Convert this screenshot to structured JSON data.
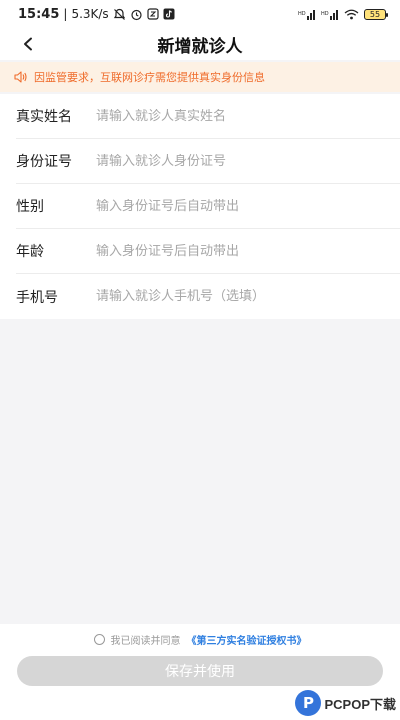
{
  "status_bar": {
    "time": "15:45",
    "speed": "5.3K/s",
    "battery": "55"
  },
  "navbar": {
    "title": "新增就诊人"
  },
  "notice": {
    "text": "因监管要求，互联网诊疗需您提供真实身份信息",
    "color": "#ef6b2a"
  },
  "form": {
    "fields": [
      {
        "label": "真实姓名",
        "placeholder": "请输入就诊人真实姓名",
        "value": ""
      },
      {
        "label": "身份证号",
        "placeholder": "请输入就诊人身份证号",
        "value": ""
      },
      {
        "label": "性别",
        "placeholder": "输入身份证号后自动带出",
        "value": ""
      },
      {
        "label": "年龄",
        "placeholder": "输入身份证号后自动带出",
        "value": ""
      },
      {
        "label": "手机号",
        "placeholder": "请输入就诊人手机号（选填）",
        "value": ""
      }
    ]
  },
  "agreement": {
    "prefix": "我已阅读并同意",
    "link": "《第三方实名验证授权书》"
  },
  "save_button": {
    "label": "保存并使用"
  },
  "watermark": {
    "logo_letter": "P",
    "text": "PCPOP下载"
  },
  "colors": {
    "accent_link": "#2f7fe0",
    "notice_bg": "#fdf1e4",
    "button_disabled": "#d6d6d6"
  }
}
